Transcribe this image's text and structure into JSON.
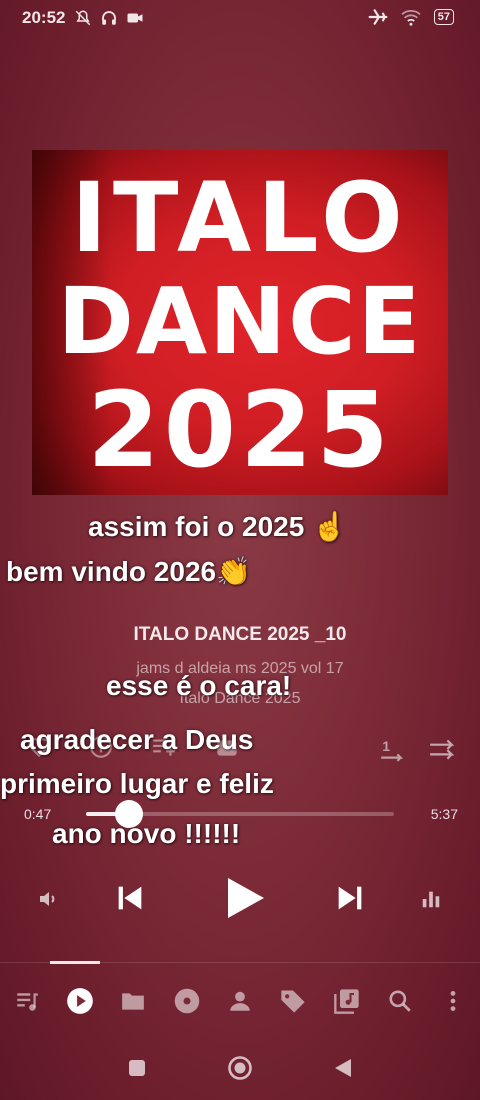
{
  "status_bar": {
    "time": "20:52",
    "left_icons": [
      "mute-icon",
      "headphones-icon",
      "camera-icon"
    ],
    "right_icons": [
      "airplane-icon",
      "wifi-icon",
      "battery-icon"
    ],
    "battery": "57"
  },
  "cover_art": {
    "line1": "ITALO",
    "line2": "DANCE",
    "line3": "2025"
  },
  "overlays": {
    "c1": "assim foi o 2025 ☝️",
    "c2": "bem vindo 2026👏",
    "c3": "esse é o cara!",
    "c4": "agradecer a Deus",
    "c5": "primeiro lugar e feliz",
    "c6": "ano novo !!!!!!"
  },
  "track": {
    "title": "ITALO DANCE 2025  _10",
    "artist": "jams d aldeia ms 2025 vol 17",
    "album": "Italo Dance 2025"
  },
  "progress": {
    "current": "0:47",
    "total": "5:37",
    "fraction": 0.14
  },
  "controls": [
    "volume-icon",
    "previous-icon",
    "play-icon",
    "next-icon",
    "equalizer-icon"
  ],
  "nav": [
    "queue-icon",
    "now-playing-icon",
    "folder-icon",
    "album-icon",
    "artist-icon",
    "tag-icon",
    "library-icon",
    "search-icon",
    "more-icon"
  ],
  "colors": {
    "background": "#7c2a37",
    "cover_red": "#d6202a",
    "accent": "#ffffff"
  }
}
